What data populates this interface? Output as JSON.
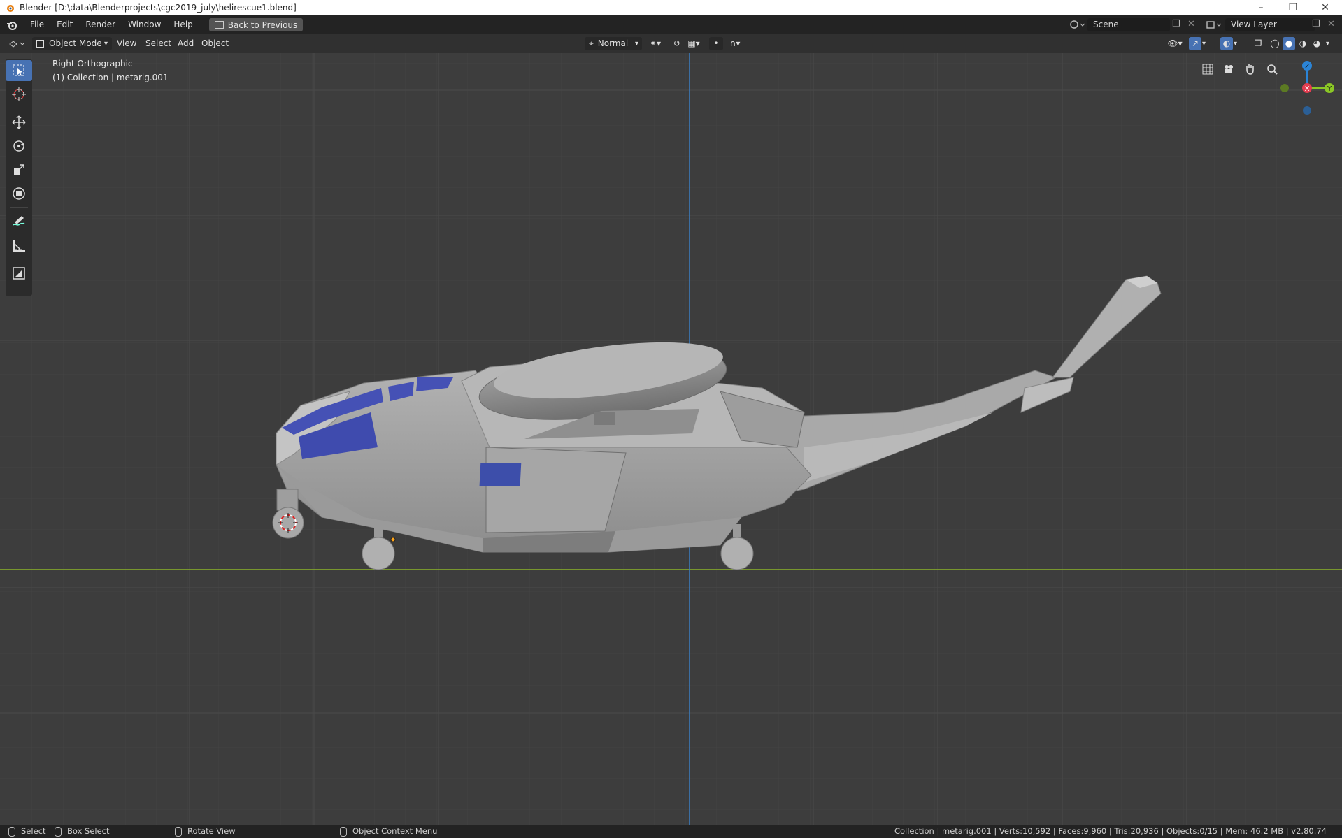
{
  "window": {
    "title": "Blender [D:\\data\\Blenderprojects\\cgc2019_july\\helirescue1.blend]",
    "controls": [
      "minimize",
      "restore",
      "close"
    ]
  },
  "menubar": {
    "items": [
      "File",
      "Edit",
      "Render",
      "Window",
      "Help"
    ],
    "back_button": "Back to Previous",
    "scene_label": "Scene",
    "view_layer_label": "View Layer"
  },
  "header": {
    "mode": "Object Mode",
    "menus": [
      "View",
      "Select",
      "Add",
      "Object"
    ],
    "orientation": "Normal"
  },
  "viewport": {
    "view_name": "Right Orthographic",
    "collection_info": "(1) Collection | metarig.001",
    "gizmo": {
      "z": "Z",
      "x": "X",
      "y": "Y"
    },
    "axis_colors": {
      "x": "#e23d50",
      "y": "#8bc726",
      "z": "#2b84d6"
    }
  },
  "tools": [
    "select-box",
    "cursor",
    "move",
    "rotate",
    "scale",
    "transform",
    "annotate",
    "measure",
    "add-cube"
  ],
  "statusbar": {
    "select": "Select",
    "box_select": "Box Select",
    "rotate_view": "Rotate View",
    "context_menu": "Object Context Menu",
    "stats": "Collection | metarig.001 | Verts:10,592 | Faces:9,960 | Tris:20,936 | Objects:0/15 | Mem: 46.2 MB | v2.80.74"
  }
}
